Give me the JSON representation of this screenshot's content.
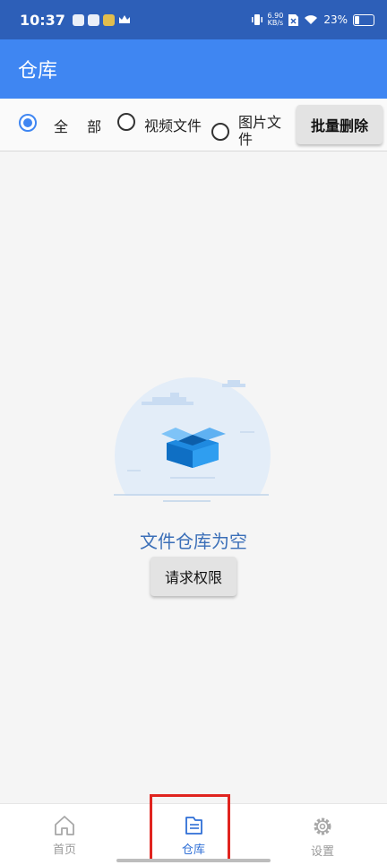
{
  "status_bar": {
    "time": "10:37",
    "net_speed_value": "6.90",
    "net_speed_unit": "KB/s",
    "battery": "23%"
  },
  "app_bar": {
    "title": "仓库"
  },
  "filters": {
    "options": [
      {
        "label": "全 部",
        "checked": true
      },
      {
        "label": "视频文件",
        "checked": false
      },
      {
        "label": "图片文件",
        "checked": false
      }
    ],
    "batch_delete_label": "批量删除"
  },
  "empty_state": {
    "message": "文件仓库为空",
    "button_label": "请求权限"
  },
  "bottom_nav": {
    "items": [
      {
        "label": "首页",
        "icon": "home-icon",
        "active": false
      },
      {
        "label": "仓库",
        "icon": "storage-icon",
        "active": true
      },
      {
        "label": "设置",
        "icon": "gear-icon",
        "active": false
      }
    ]
  },
  "colors": {
    "status_bar": "#2d5fb8",
    "app_bar": "#3f86f2",
    "accent": "#3f86f2",
    "highlight": "#e0241f"
  }
}
